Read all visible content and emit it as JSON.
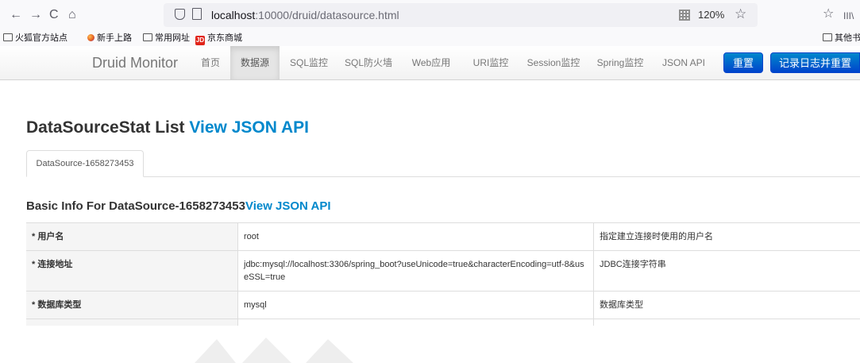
{
  "browser": {
    "back": "←",
    "forward": "→",
    "reload": "C",
    "home": "⌂",
    "url_host": "localhost",
    "url_rest": ":10000/druid/datasource.html",
    "zoom": "120%",
    "star": "☆",
    "right_icons": [
      "☆",
      "III\\"
    ]
  },
  "bookmarks": {
    "items": [
      "火狐官方站点",
      "新手上路",
      "常用网址",
      "京东商城"
    ],
    "jd_badge": "JD",
    "other": "其他书签"
  },
  "nav": {
    "brand": "Druid Monitor",
    "items": [
      "首页",
      "数据源",
      "SQL监控",
      "SQL防火墙",
      "Web应用",
      "URI监控",
      "Session监控",
      "Spring监控",
      "JSON API"
    ],
    "reset": "重置",
    "log_reset": "记录日志并重置"
  },
  "content": {
    "title": "DataSourceStat List ",
    "title_link": "View JSON API",
    "tab": "DataSource-1658273453",
    "sub_title": "Basic Info For DataSource-1658273453",
    "sub_link": "View JSON API",
    "rows": [
      {
        "key": "* 用户名",
        "value": "root",
        "desc": "指定建立连接时使用的用户名"
      },
      {
        "key": "* 连接地址",
        "value": "jdbc:mysql://localhost:3306/spring_boot?useUnicode=true&characterEncoding=utf-8&useSSL=true",
        "desc": "JDBC连接字符串"
      },
      {
        "key": "* 数据库类型",
        "value": "mysql",
        "desc": "数据库类型"
      }
    ]
  }
}
